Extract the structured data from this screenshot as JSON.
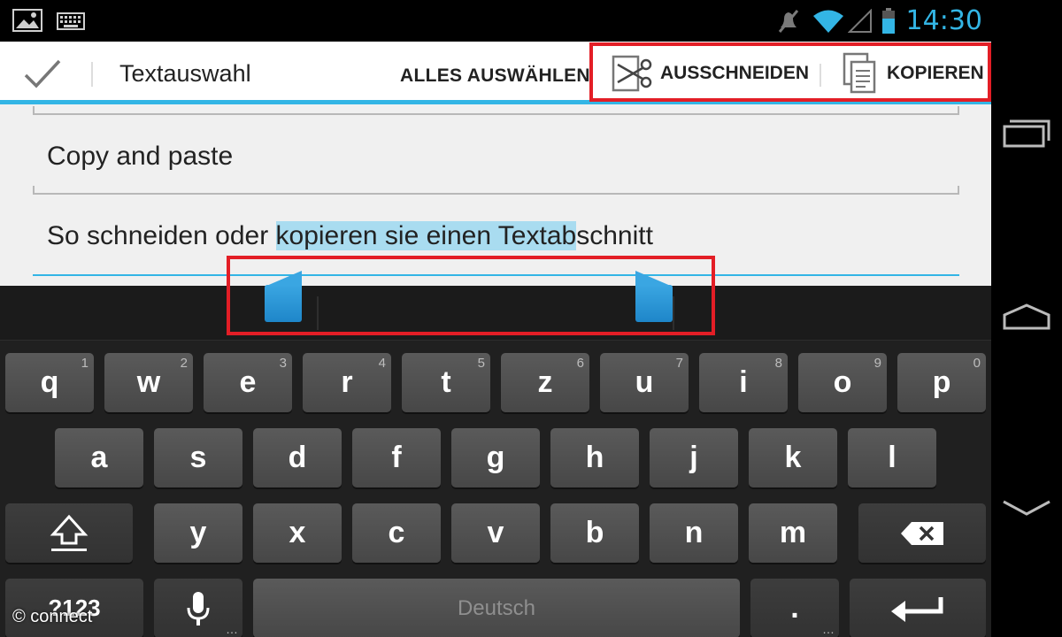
{
  "status_bar": {
    "time": "14:30",
    "icons": [
      "image-notification-icon",
      "keyboard-notification-icon",
      "mute-icon",
      "wifi-icon",
      "signal-icon",
      "battery-icon"
    ]
  },
  "action_bar": {
    "title": "Textauswahl",
    "select_all_label": "ALLES AUSWÄHLEN",
    "cut_label": "AUSSCHNEIDEN",
    "copy_label": "KOPIEREN",
    "accent_color": "#33b5e5",
    "highlight_color": "#e31e26"
  },
  "content": {
    "field1_text": "Copy and paste",
    "field2_before": "So schneiden oder ",
    "field2_selected": "kopieren sie einen Textab",
    "field2_after": "schnitt",
    "selection_color": "#a9dcf0"
  },
  "keyboard": {
    "row1": [
      {
        "label": "q",
        "hint": "1"
      },
      {
        "label": "w",
        "hint": "2"
      },
      {
        "label": "e",
        "hint": "3"
      },
      {
        "label": "r",
        "hint": "4"
      },
      {
        "label": "t",
        "hint": "5"
      },
      {
        "label": "z",
        "hint": "6"
      },
      {
        "label": "u",
        "hint": "7"
      },
      {
        "label": "i",
        "hint": "8"
      },
      {
        "label": "o",
        "hint": "9"
      },
      {
        "label": "p",
        "hint": "0"
      }
    ],
    "row2": [
      {
        "label": "a"
      },
      {
        "label": "s"
      },
      {
        "label": "d"
      },
      {
        "label": "f"
      },
      {
        "label": "g"
      },
      {
        "label": "h"
      },
      {
        "label": "j"
      },
      {
        "label": "k"
      },
      {
        "label": "l"
      }
    ],
    "row3": [
      {
        "label": "y"
      },
      {
        "label": "x"
      },
      {
        "label": "c"
      },
      {
        "label": "v"
      },
      {
        "label": "b"
      },
      {
        "label": "n"
      },
      {
        "label": "m"
      }
    ],
    "symbols_label": "?123",
    "space_label": "Deutsch",
    "period_label": ".",
    "more_dots": "…"
  },
  "watermark": "© connect"
}
